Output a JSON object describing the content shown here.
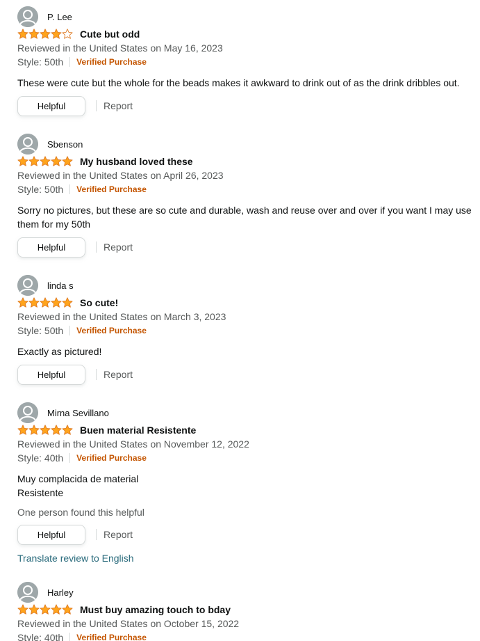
{
  "colors": {
    "star": "#ffa41c",
    "star_outline": "#de7921",
    "verified": "#c45500",
    "link": "#2a6b7c",
    "meta_text": "#565959"
  },
  "icons": {
    "avatar": "default-user-avatar-icon",
    "star": "star-icon"
  },
  "reviews": [
    {
      "author": "P. Lee",
      "rating": 4,
      "title": "Cute but odd",
      "date": "Reviewed in the United States on May 16, 2023",
      "style": "Style: 50th",
      "verified": "Verified Purchase",
      "body": "These were cute but the whole for the beads makes it awkward to drink out of as the drink dribbles out.",
      "helpful_label": "Helpful",
      "report_label": "Report"
    },
    {
      "author": "Sbenson",
      "rating": 5,
      "title": "My husband loved these",
      "date": "Reviewed in the United States on April 26, 2023",
      "style": "Style: 50th",
      "verified": "Verified Purchase",
      "body": "Sorry no pictures, but these are so cute and durable, wash and reuse over and over if you want I may use them for my 50th",
      "helpful_label": "Helpful",
      "report_label": "Report"
    },
    {
      "author": "linda s",
      "rating": 5,
      "title": "So cute!",
      "date": "Reviewed in the United States on March 3, 2023",
      "style": "Style: 50th",
      "verified": "Verified Purchase",
      "body": "Exactly as pictured!",
      "helpful_label": "Helpful",
      "report_label": "Report"
    },
    {
      "author": "Mirna Sevillano",
      "rating": 5,
      "title": "Buen material Resistente",
      "date": "Reviewed in the United States on November 12, 2022",
      "style": "Style: 40th",
      "verified": "Verified Purchase",
      "body_lines": [
        "Muy complacida de material",
        "Resistente"
      ],
      "helpful_count": "One person found this helpful",
      "helpful_label": "Helpful",
      "report_label": "Report",
      "translate_label": "Translate review to English"
    },
    {
      "author": "Harley",
      "rating": 5,
      "title": "Must buy amazing touch to bday",
      "date": "Reviewed in the United States on October 15, 2022",
      "style": "Style: 40th",
      "verified": "Verified Purchase"
    }
  ]
}
